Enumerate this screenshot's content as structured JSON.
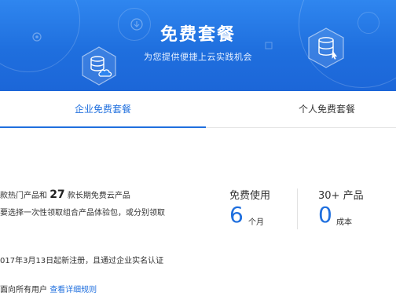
{
  "banner": {
    "title": "免费套餐",
    "subtitle": "为您提供便捷上云实践机会"
  },
  "tabs": [
    {
      "label": "企业免费套餐",
      "active": true
    },
    {
      "label": "个人免费套餐",
      "active": false
    }
  ],
  "content": {
    "line1_prefix": "款热门产品和",
    "line1_count": "27",
    "line1_suffix": "款长期免费云产品",
    "line2": "要选择一次性领取组合产品体验包，或分别领取",
    "line3": "017年3月13日起新注册，且通过企业实名认证",
    "line4_prefix": "面向所有用户",
    "line4_link": "查看详细规则"
  },
  "stats": [
    {
      "label": "免费使用",
      "value": "6",
      "unit": "个月"
    },
    {
      "label": "30+ 产品",
      "value": "0",
      "unit": "成本"
    }
  ],
  "colors": {
    "accent": "#1f6fde",
    "banner_top": "#2f86ef",
    "banner_bottom": "#1c66d8"
  }
}
